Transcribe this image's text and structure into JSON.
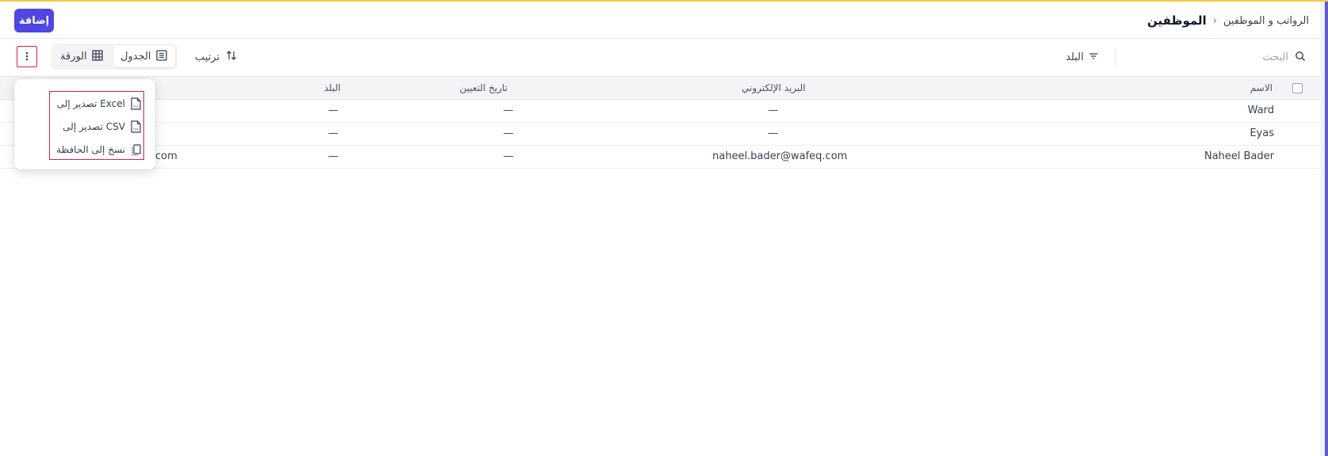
{
  "header": {
    "add_button": "إضافة",
    "breadcrumb_parent": "الرواتب و الموظفين",
    "breadcrumb_separator": "›",
    "title": "الموظفين"
  },
  "toolbar": {
    "search_placeholder": "البحث",
    "filter_label": "البلد",
    "sort_label": "ترتيب",
    "view_table_label": "الجدول",
    "view_sheet_label": "الورقة",
    "active_view": "الجدول"
  },
  "table": {
    "columns": [
      "الاسم",
      "البريد الإلكتروني",
      "تاريخ التعيين",
      "البلد"
    ],
    "rows": [
      {
        "name": "Ward",
        "email": "—",
        "hire_date": "—",
        "country": "—",
        "extra": ""
      },
      {
        "name": "Eyas",
        "email": "—",
        "hire_date": "—",
        "country": "—",
        "extra": ""
      },
      {
        "name": "Naheel Bader",
        "email": "naheel.bader@wafeq.com",
        "hire_date": "—",
        "country": "—",
        "extra": "com"
      }
    ]
  },
  "menu": {
    "items": [
      {
        "label": "تصدير إلى Excel",
        "icon": "xls-file-icon"
      },
      {
        "label": "تصدير إلى CSV",
        "icon": "csv-file-icon"
      },
      {
        "label": "نسخ إلى الحافظة",
        "icon": "clipboard-icon"
      }
    ]
  },
  "colors": {
    "primary": "#4f46e5",
    "top_accent": "#f5c842",
    "highlight": "#e11d48"
  }
}
